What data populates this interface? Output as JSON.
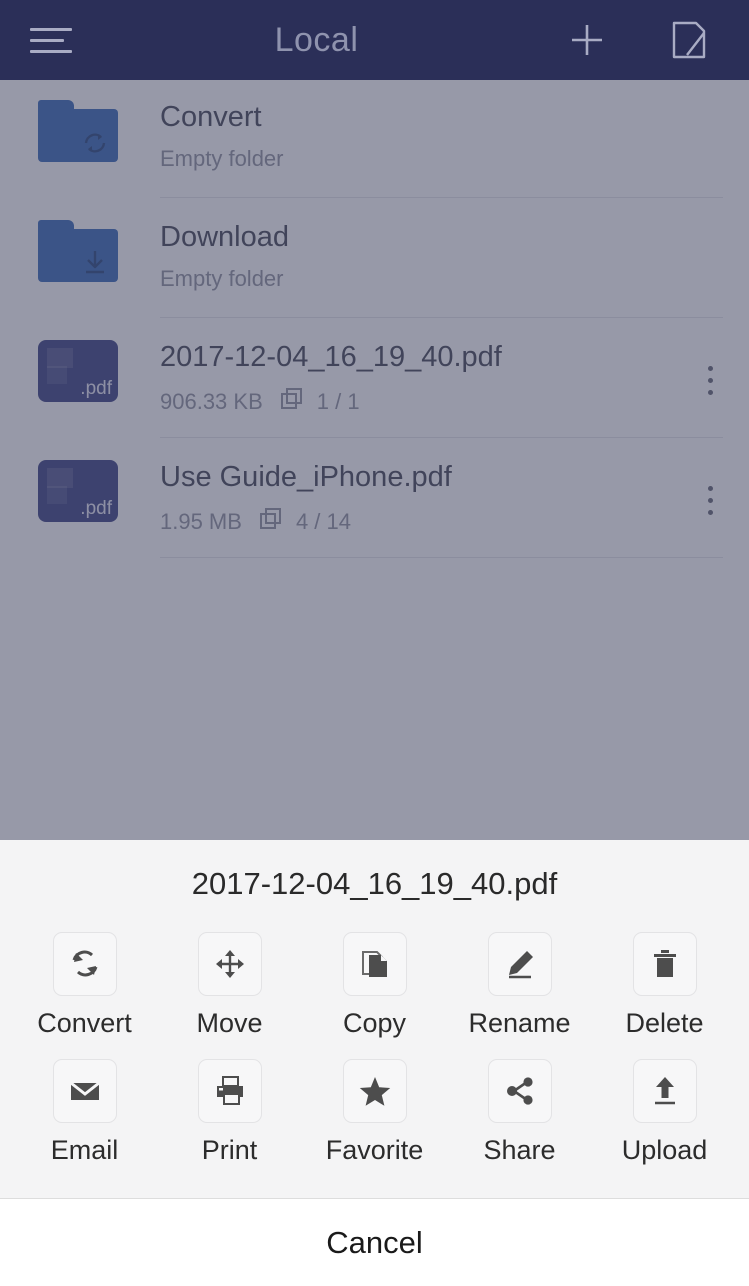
{
  "header": {
    "title": "Local",
    "menu_icon": "hamburger-menu-icon",
    "add_icon": "plus-icon",
    "edit_icon": "edit-document-icon"
  },
  "file_list": [
    {
      "name": "Convert",
      "subtitle": "Empty folder",
      "icon": "folder-sync-icon",
      "type": "folder",
      "size": "",
      "pages": "",
      "has_menu": false
    },
    {
      "name": "Download",
      "subtitle": "Empty folder",
      "icon": "folder-download-icon",
      "type": "folder",
      "size": "",
      "pages": "",
      "has_menu": false
    },
    {
      "name": "2017-12-04_16_19_40.pdf",
      "subtitle": "",
      "icon": "pdf-file-icon",
      "type": "pdf",
      "ext_label": ".pdf",
      "size": "906.33 KB",
      "pages": "1 / 1",
      "has_menu": true
    },
    {
      "name": "Use Guide_iPhone.pdf",
      "subtitle": "",
      "icon": "pdf-file-icon",
      "type": "pdf",
      "ext_label": ".pdf",
      "size": "1.95 MB",
      "pages": "4 / 14",
      "has_menu": true
    }
  ],
  "action_sheet": {
    "title": "2017-12-04_16_19_40.pdf",
    "actions": [
      {
        "label": "Convert",
        "icon": "convert-sync-icon"
      },
      {
        "label": "Move",
        "icon": "move-arrows-icon"
      },
      {
        "label": "Copy",
        "icon": "copy-documents-icon"
      },
      {
        "label": "Rename",
        "icon": "pencil-edit-icon"
      },
      {
        "label": "Delete",
        "icon": "trash-can-icon"
      },
      {
        "label": "Email",
        "icon": "envelope-icon"
      },
      {
        "label": "Print",
        "icon": "printer-icon"
      },
      {
        "label": "Favorite",
        "icon": "star-icon"
      },
      {
        "label": "Share",
        "icon": "share-nodes-icon"
      },
      {
        "label": "Upload",
        "icon": "upload-arrow-icon"
      }
    ],
    "cancel_label": "Cancel"
  },
  "colors": {
    "header_bg": "#2b2f58",
    "header_text": "#8f93ae",
    "folder_blue": "#2f62b3",
    "pdf_indigo": "#343a7e",
    "overlay": "rgba(70,73,100,.56)",
    "sheet_bg": "#f4f4f5"
  }
}
